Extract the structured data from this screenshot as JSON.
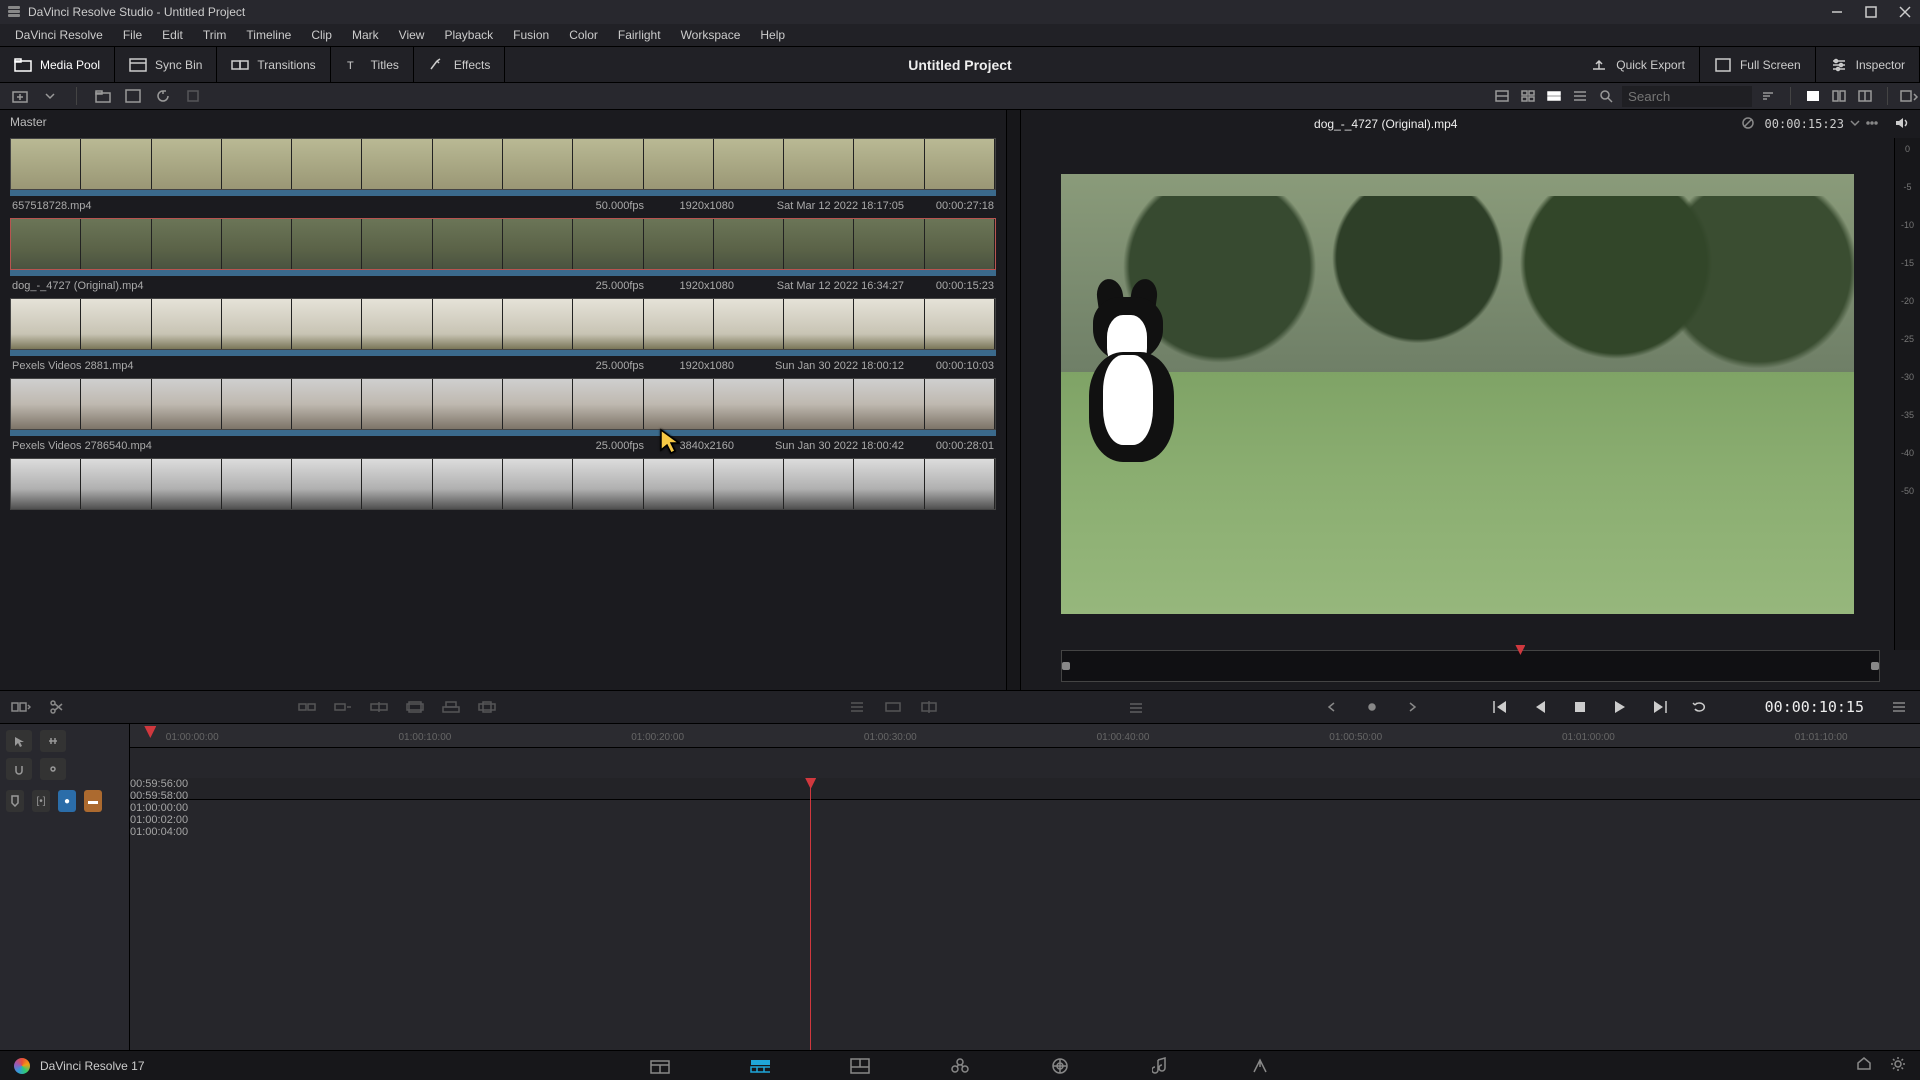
{
  "window": {
    "title": "DaVinci Resolve Studio - Untitled Project"
  },
  "menubar": [
    "DaVinci Resolve",
    "File",
    "Edit",
    "Trim",
    "Timeline",
    "Clip",
    "Mark",
    "View",
    "Playback",
    "Fusion",
    "Color",
    "Fairlight",
    "Workspace",
    "Help"
  ],
  "pagetool": {
    "media_pool": "Media Pool",
    "sync_bin": "Sync Bin",
    "transitions": "Transitions",
    "titles": "Titles",
    "effects": "Effects",
    "project_title": "Untitled Project",
    "quick_export": "Quick Export",
    "full_screen": "Full Screen",
    "inspector": "Inspector"
  },
  "search": {
    "placeholder": "Search"
  },
  "master_label": "Master",
  "clips": [
    {
      "name": "657518728.mp4",
      "fps": "50.000fps",
      "res": "1920x1080",
      "date": "Sat Mar 12 2022 18:17:05",
      "dur": "00:00:27:18"
    },
    {
      "name": "dog_-_4727 (Original).mp4",
      "fps": "25.000fps",
      "res": "1920x1080",
      "date": "Sat Mar 12 2022 16:34:27",
      "dur": "00:00:15:23"
    },
    {
      "name": "Pexels Videos 2881.mp4",
      "fps": "25.000fps",
      "res": "1920x1080",
      "date": "Sun Jan 30 2022 18:00:12",
      "dur": "00:00:10:03"
    },
    {
      "name": "Pexels Videos 2786540.mp4",
      "fps": "25.000fps",
      "res": "3840x2160",
      "date": "Sun Jan 30 2022 18:00:42",
      "dur": "00:00:28:01"
    },
    {
      "name": "",
      "fps": "",
      "res": "",
      "date": "",
      "dur": ""
    }
  ],
  "viewer": {
    "clip_name": "dog_-_4727 (Original).mp4",
    "timecode": "00:00:15:23"
  },
  "meter_labels": [
    "0",
    "-5",
    "-10",
    "-15",
    "-20",
    "-25",
    "-30",
    "-35",
    "-40",
    "-50"
  ],
  "transport": {
    "timecode": "00:00:10:15"
  },
  "upper_ruler": {
    "playhead_pct": 0.8,
    "ticks": [
      {
        "pct": 2,
        "label": "01:00:00:00"
      },
      {
        "pct": 15,
        "label": "01:00:10:00"
      },
      {
        "pct": 28,
        "label": "01:00:20:00"
      },
      {
        "pct": 41,
        "label": "01:00:30:00"
      },
      {
        "pct": 54,
        "label": "01:00:40:00"
      },
      {
        "pct": 67,
        "label": "01:00:50:00"
      },
      {
        "pct": 80,
        "label": "01:01:00:00"
      },
      {
        "pct": 93,
        "label": "01:01:10:00"
      }
    ]
  },
  "lower_ruler": {
    "playhead_pct": 38,
    "ticks": [
      {
        "pct": 10,
        "label": "00:59:56:00"
      },
      {
        "pct": 24,
        "label": "00:59:58:00"
      },
      {
        "pct": 38,
        "label": "01:00:00:00"
      },
      {
        "pct": 52,
        "label": "01:00:02:00"
      },
      {
        "pct": 66,
        "label": "01:00:04:00"
      }
    ]
  },
  "footer": {
    "app": "DaVinci Resolve 17"
  }
}
